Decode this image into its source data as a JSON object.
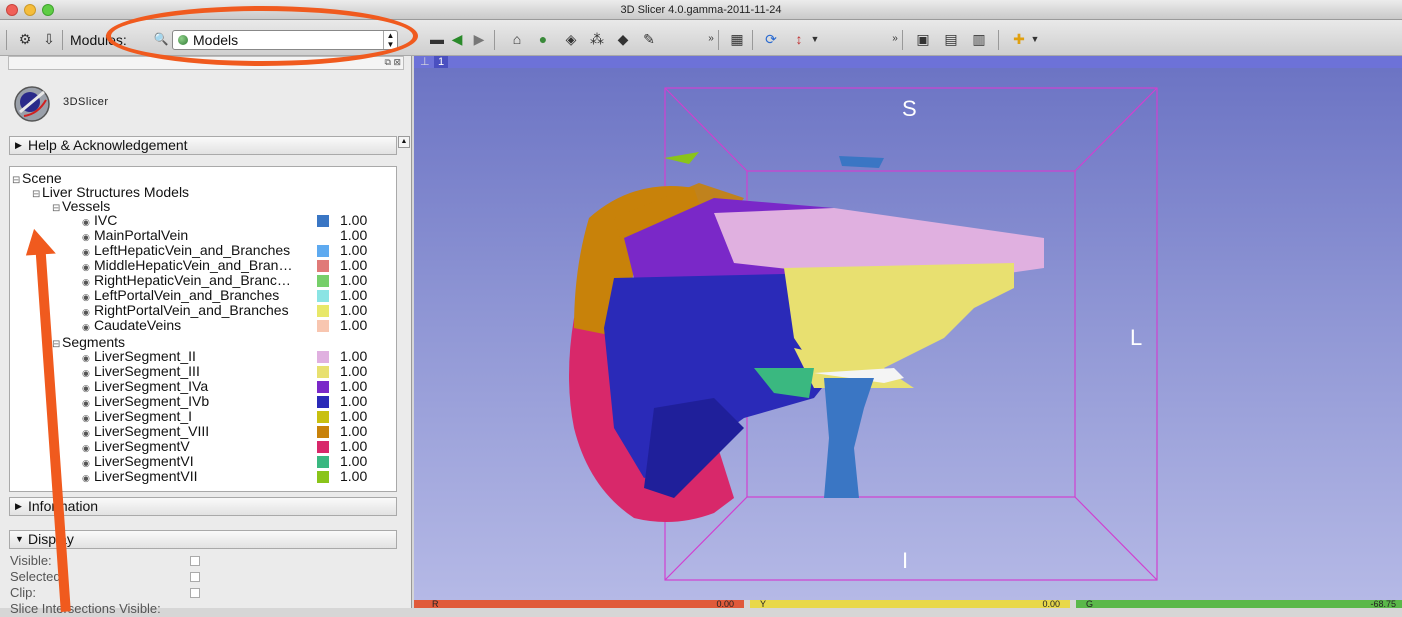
{
  "window": {
    "title": "3D Slicer 4.0.gamma-2011-11-24"
  },
  "toolbar": {
    "modules_label": "Modules:",
    "module_selected": "Models"
  },
  "logo": {
    "text": "3DSlicer"
  },
  "sections": {
    "help": "Help & Acknowledgement",
    "information": "Information",
    "display": "Display"
  },
  "tree": {
    "scene": "Scene",
    "model_hierarchy": "Liver Structures Models",
    "vessels_group": "Vessels",
    "segments_group": "Segments",
    "vessels": [
      {
        "name": "IVC",
        "color": "#3a76c4",
        "opacity": "1.00"
      },
      {
        "name": "MainPortalVein",
        "color": "",
        "opacity": "1.00"
      },
      {
        "name": "LeftHepaticVein_and_Branches",
        "color": "#5eaaf0",
        "opacity": "1.00"
      },
      {
        "name": "MiddleHepaticVein_and_Bran…",
        "color": "#e07a78",
        "opacity": "1.00"
      },
      {
        "name": "RightHepaticVein_and_Branc…",
        "color": "#76cf6a",
        "opacity": "1.00"
      },
      {
        "name": "LeftPortalVein_and_Branches",
        "color": "#8ae4e4",
        "opacity": "1.00"
      },
      {
        "name": "RightPortalVein_and_Branches",
        "color": "#e8e86a",
        "opacity": "1.00"
      },
      {
        "name": "CaudateVeins",
        "color": "#f8c6b0",
        "opacity": "1.00"
      }
    ],
    "segments": [
      {
        "name": "LiverSegment_II",
        "color": "#e0b0e0",
        "opacity": "1.00"
      },
      {
        "name": "LiverSegment_III",
        "color": "#e8e070",
        "opacity": "1.00"
      },
      {
        "name": "LiverSegment_IVa",
        "color": "#7a28c8",
        "opacity": "1.00"
      },
      {
        "name": "LiverSegment_IVb",
        "color": "#2a2ab8",
        "opacity": "1.00"
      },
      {
        "name": "LiverSegment_I",
        "color": "#c8c010",
        "opacity": "1.00"
      },
      {
        "name": "LiverSegment_VIII",
        "color": "#c8820a",
        "opacity": "1.00"
      },
      {
        "name": "LiverSegmentV",
        "color": "#d8286a",
        "opacity": "1.00"
      },
      {
        "name": "LiverSegmentVI",
        "color": "#3ab880",
        "opacity": "1.00"
      },
      {
        "name": "LiverSegmentVII",
        "color": "#8ac41a",
        "opacity": "1.00"
      }
    ]
  },
  "display_fields": [
    "Visible:",
    "Selected:",
    "Clip:",
    "Slice Intersections Visible:"
  ],
  "view": {
    "number": "1",
    "labels": {
      "superior": "S",
      "inferior": "I",
      "left": "L"
    }
  },
  "slice_bars": [
    {
      "name": "R",
      "value": "0.00",
      "color": "#e05a3a"
    },
    {
      "name": "Y",
      "value": "0.00",
      "color": "#e8d84a"
    },
    {
      "name": "G",
      "value": "-68.75",
      "color": "#5ab84a"
    }
  ],
  "colors": {
    "annotation": "#f05a1e",
    "view_bg": "#8e95d4"
  }
}
